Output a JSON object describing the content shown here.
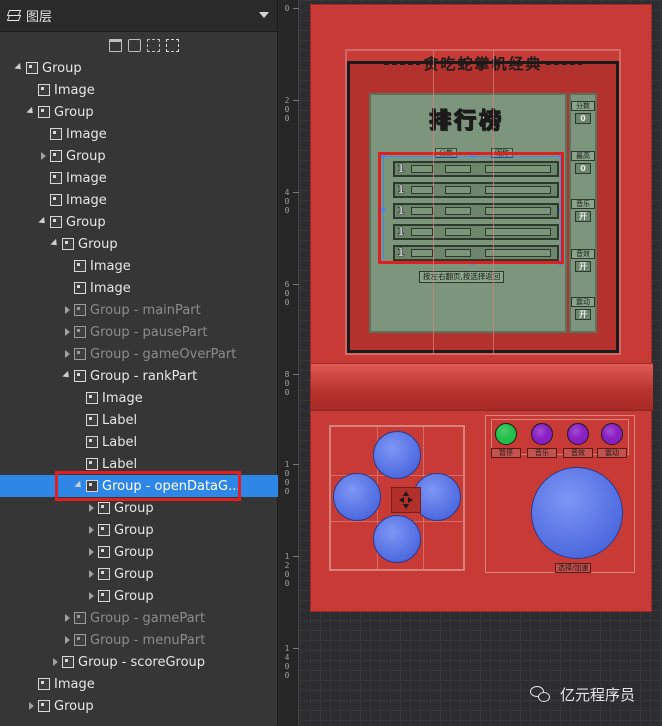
{
  "panel": {
    "title": "图层",
    "toolbar_icons": [
      "trash-icon",
      "copy-icon",
      "group-icon",
      "ungroup-icon"
    ]
  },
  "tree": [
    {
      "label": "Group",
      "level": 0,
      "toggle": "open",
      "dim": false
    },
    {
      "label": "Image",
      "level": 1,
      "toggle": "none",
      "dim": false
    },
    {
      "label": "Group",
      "level": 1,
      "toggle": "open",
      "dim": false
    },
    {
      "label": "Image",
      "level": 2,
      "toggle": "none",
      "dim": false
    },
    {
      "label": "Group",
      "level": 2,
      "toggle": "closed",
      "dim": false
    },
    {
      "label": "Image",
      "level": 2,
      "toggle": "none",
      "dim": false
    },
    {
      "label": "Image",
      "level": 2,
      "toggle": "none",
      "dim": false
    },
    {
      "label": "Group",
      "level": 2,
      "toggle": "open",
      "dim": false
    },
    {
      "label": "Group",
      "level": 3,
      "toggle": "open",
      "dim": false
    },
    {
      "label": "Image",
      "level": 4,
      "toggle": "none",
      "dim": false
    },
    {
      "label": "Image",
      "level": 4,
      "toggle": "none",
      "dim": false
    },
    {
      "label": "Group - mainPart",
      "level": 4,
      "toggle": "closed",
      "dim": true
    },
    {
      "label": "Group - pausePart",
      "level": 4,
      "toggle": "closed",
      "dim": true
    },
    {
      "label": "Group - gameOverPart",
      "level": 4,
      "toggle": "closed",
      "dim": true
    },
    {
      "label": "Group - rankPart",
      "level": 4,
      "toggle": "open",
      "dim": false
    },
    {
      "label": "Image",
      "level": 5,
      "toggle": "none",
      "dim": false
    },
    {
      "label": "Label",
      "level": 5,
      "toggle": "none",
      "dim": false
    },
    {
      "label": "Label",
      "level": 5,
      "toggle": "none",
      "dim": false
    },
    {
      "label": "Label",
      "level": 5,
      "toggle": "none",
      "dim": false
    },
    {
      "label": "Group - openDataG...",
      "level": 5,
      "toggle": "open",
      "dim": false,
      "selected": true
    },
    {
      "label": "Group",
      "level": 6,
      "toggle": "closed",
      "dim": false
    },
    {
      "label": "Group",
      "level": 6,
      "toggle": "closed",
      "dim": false
    },
    {
      "label": "Group",
      "level": 6,
      "toggle": "closed",
      "dim": false
    },
    {
      "label": "Group",
      "level": 6,
      "toggle": "closed",
      "dim": false
    },
    {
      "label": "Group",
      "level": 6,
      "toggle": "closed",
      "dim": false
    },
    {
      "label": "Group - gamePart",
      "level": 4,
      "toggle": "closed",
      "dim": true
    },
    {
      "label": "Group - menuPart",
      "level": 4,
      "toggle": "closed",
      "dim": true
    },
    {
      "label": "Group - scoreGroup",
      "level": 3,
      "toggle": "closed",
      "dim": false
    },
    {
      "label": "Image",
      "level": 1,
      "toggle": "none",
      "dim": false
    },
    {
      "label": "Group",
      "level": 1,
      "toggle": "closed",
      "dim": false
    }
  ],
  "ruler": {
    "labels": [
      [
        "0"
      ],
      [
        "2",
        "0",
        "0"
      ],
      [
        "4",
        "0",
        "0"
      ],
      [
        "6",
        "0",
        "0"
      ],
      [
        "8",
        "0",
        "0"
      ],
      [
        "1",
        "0",
        "0",
        "0"
      ],
      [
        "1",
        "2",
        "0",
        "0"
      ],
      [
        "1",
        "4",
        "0",
        "0"
      ]
    ]
  },
  "game": {
    "title": "贪吃蛇掌机经典",
    "rank_title": "排行榜",
    "col_score": "分数",
    "col_name": "昵称",
    "rank_numbers": [
      "1",
      "1",
      "1",
      "1",
      "1"
    ],
    "hint": "按左右翻页,按选择返回",
    "side": [
      {
        "label": "分数",
        "value": "0"
      },
      {
        "label": "最高",
        "value": "0"
      },
      {
        "label": "音乐",
        "value": "开"
      },
      {
        "label": "音效",
        "value": "开"
      },
      {
        "label": "震动",
        "value": "开"
      }
    ],
    "small_buttons": [
      {
        "label": "暂停",
        "color": "#22c04a"
      },
      {
        "label": "音乐",
        "color": "#8a1fc4"
      },
      {
        "label": "音效",
        "color": "#8a1fc4"
      },
      {
        "label": "震动",
        "color": "#8a1fc4"
      }
    ],
    "big_button_label": "选择/加速"
  },
  "watermark": {
    "text": "亿元程序员"
  },
  "colors": {
    "selection": "#2e86e6",
    "highlight": "#e02020",
    "device": "#c83a35",
    "lcd": "#7c957c",
    "button_blue": "#5b74e8"
  }
}
